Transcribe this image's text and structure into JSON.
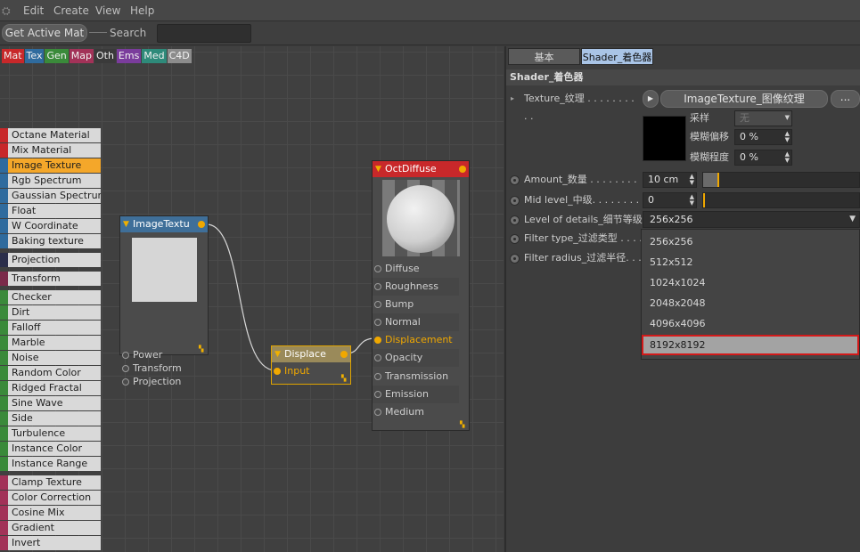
{
  "menubar": {
    "items": [
      "Edit",
      "Create",
      "View",
      "Help"
    ]
  },
  "toolbar": {
    "get_active_mat": "Get Active Mat",
    "search_label": "Search"
  },
  "category_tabs": [
    {
      "label": "Mat",
      "color": "#c8282a"
    },
    {
      "label": "Tex",
      "color": "#2f6b9e"
    },
    {
      "label": "Gen",
      "color": "#3a8a3a"
    },
    {
      "label": "Map",
      "color": "#a23258"
    },
    {
      "label": "Oth",
      "color": "#3a3a3a"
    },
    {
      "label": "Ems",
      "color": "#7a3c9c"
    },
    {
      "label": "Med",
      "color": "#2e8a7a"
    },
    {
      "label": "C4D",
      "color": "#8c8c8c"
    }
  ],
  "node_list": [
    {
      "label": "Octane Material",
      "color": "#c8282a"
    },
    {
      "label": "Mix Material",
      "color": "#c8282a"
    },
    {
      "label": "Image Texture",
      "color": "#2f6b9e",
      "selected": true
    },
    {
      "label": "Rgb Spectrum",
      "color": "#2f6b9e"
    },
    {
      "label": "Gaussian Spectrum",
      "color": "#2f6b9e"
    },
    {
      "label": "Float",
      "color": "#2f6b9e"
    },
    {
      "label": "W Coordinate",
      "color": "#2f6b9e"
    },
    {
      "label": "Baking texture",
      "color": "#2f6b9e"
    },
    {
      "gap": true
    },
    {
      "label": "Projection",
      "color": "#2b2e4a"
    },
    {
      "gap": true
    },
    {
      "label": "Transform",
      "color": "#7b2a4a"
    },
    {
      "gap": true
    },
    {
      "label": "Checker",
      "color": "#3a8a3a"
    },
    {
      "label": "Dirt",
      "color": "#3a8a3a"
    },
    {
      "label": "Falloff",
      "color": "#3a8a3a"
    },
    {
      "label": "Marble",
      "color": "#3a8a3a"
    },
    {
      "label": "Noise",
      "color": "#3a8a3a"
    },
    {
      "label": "Random Color",
      "color": "#3a8a3a"
    },
    {
      "label": "Ridged Fractal",
      "color": "#3a8a3a"
    },
    {
      "label": "Sine Wave",
      "color": "#3a8a3a"
    },
    {
      "label": "Side",
      "color": "#3a8a3a"
    },
    {
      "label": "Turbulence",
      "color": "#3a8a3a"
    },
    {
      "label": "Instance Color",
      "color": "#3a8a3a"
    },
    {
      "label": "Instance Range",
      "color": "#3a8a3a"
    },
    {
      "gap": true
    },
    {
      "label": "Clamp Texture",
      "color": "#a23258"
    },
    {
      "label": "Color Correction",
      "color": "#a23258"
    },
    {
      "label": "Cosine Mix",
      "color": "#a23258"
    },
    {
      "label": "Gradient",
      "color": "#a23258"
    },
    {
      "label": "Invert",
      "color": "#a23258"
    }
  ],
  "nodes": {
    "image_texture": {
      "title": "ImageTextu",
      "header_color": "#3f6f99",
      "ports": [
        "Power",
        "Transform",
        "Projection"
      ]
    },
    "displace": {
      "title": "Displace",
      "header_color": "#9a8a5a",
      "ports": [
        "Input"
      ]
    },
    "oct_diffuse": {
      "title": "OctDiffuse",
      "header_color": "#c8282a",
      "ports": [
        "Diffuse",
        "Roughness",
        "Bump",
        "Normal",
        "Displacement",
        "Opacity",
        "Transmission",
        "Emission",
        "Medium"
      ],
      "active_port": "Displacement"
    }
  },
  "panel": {
    "tabs": [
      {
        "label": "基本",
        "active": false
      },
      {
        "label": "Shader_着色器",
        "active": true
      }
    ],
    "section_title": "Shader_着色器",
    "texture_label": "Texture_纹理 . . . . . . . . . .",
    "texture_button": "ImageTexture_图像纹理",
    "more_button": "...",
    "sampling_label": "采样",
    "sampling_value": "无",
    "blur_offset_label": "模糊偏移",
    "blur_offset_value": "0 %",
    "blur_scale_label": "模糊程度",
    "blur_scale_value": "0 %",
    "amount_label": "Amount_数量 . . . . . . . . .",
    "amount_value": "10 cm",
    "mid_level_label": "Mid level_中级. . . . . . . .",
    "mid_level_value": "0",
    "lod_label": "Level of details_细节等级",
    "lod_value": "256x256",
    "filter_type_label": "Filter type_过滤类型 . . . .",
    "filter_radius_label": "Filter radius_过滤半径. . .",
    "dropdown_options": [
      "256x256",
      "512x512",
      "1024x1024",
      "2048x2048",
      "4096x4096",
      "8192x8192"
    ],
    "dropdown_highlight": "8192x8192"
  }
}
